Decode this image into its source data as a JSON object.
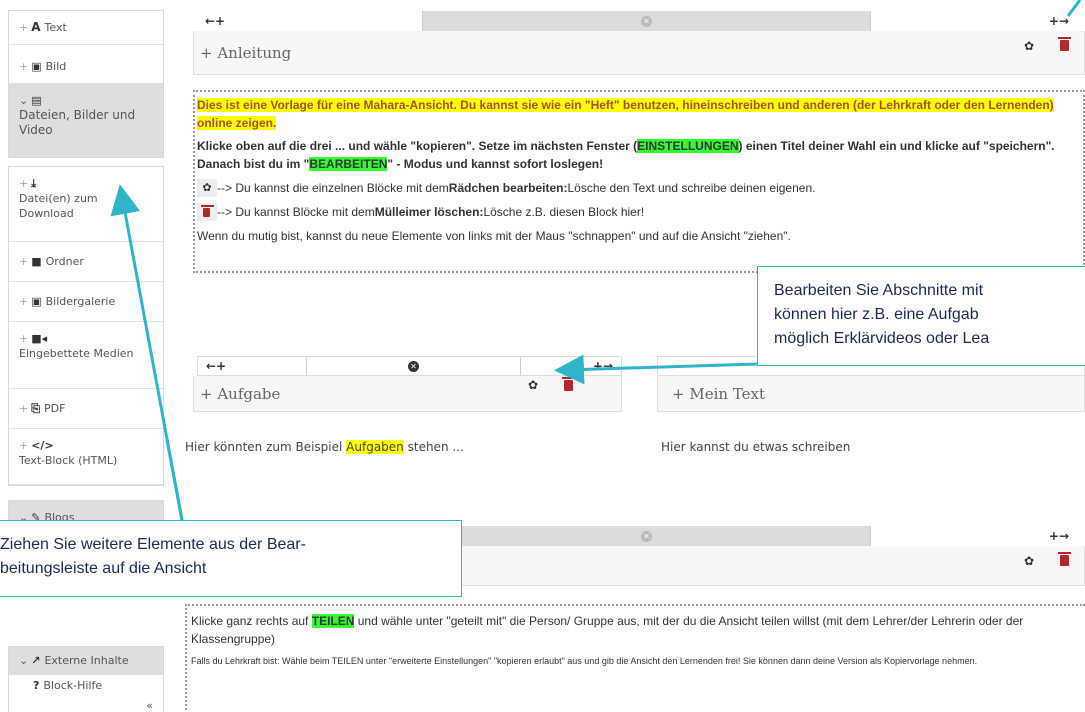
{
  "sidebar": {
    "items": [
      {
        "label": "Text",
        "icon": "text-A-icon"
      },
      {
        "label": "Bild",
        "icon": "image-icon"
      },
      {
        "label": "Dateien, Bilder und Video",
        "icon": "film-icon",
        "category": true
      },
      {
        "label": "Datei(en) zum Download",
        "icon": "download-icon"
      },
      {
        "label": "Ordner",
        "icon": "folder-icon"
      },
      {
        "label": "Bildergalerie",
        "icon": "gallery-icon"
      },
      {
        "label": "Eingebettete Medien",
        "icon": "video-camera-icon"
      },
      {
        "label": "PDF",
        "icon": "pdf-icon"
      },
      {
        "label": "Text-Block (HTML)",
        "icon": "code-icon"
      },
      {
        "label": "Blogs",
        "icon": "pencil-icon",
        "category": true
      },
      {
        "label": "Externe Inhalte",
        "icon": "external-link-icon",
        "category": true
      },
      {
        "label": "Block-Hilfe",
        "icon": "help-icon"
      }
    ],
    "collapse": "«"
  },
  "row_controls": {
    "left": "←+",
    "right": "+→"
  },
  "blocks": {
    "anleitung": {
      "title": "+ Anleitung"
    },
    "aufgabe": {
      "title": "+ Aufgabe",
      "body_pre": "Hier könnten zum Beispiel ",
      "body_hl": "Aufgaben",
      "body_post": " stehen ..."
    },
    "mein_text": {
      "title": "+ Mein Text",
      "body": "Hier kannst du etwas schreiben"
    }
  },
  "anleitung_content": {
    "p1": "Dies ist eine Vorlage für eine Mahara-Ansicht. Du kannst sie wie ein \"Heft\" benutzen, hineinschreiben und anderen (der Lehrkraft oder den Lernenden) online zeigen.",
    "p2_a": "Klicke oben auf die drei ... und wähle \"kopieren\". Setze im nächsten Fenster (",
    "p2_hl1": "EINSTELLUNGEN",
    "p2_b": ") einen Titel deiner Wahl ein und klicke auf \"speichern\". Danach bist du im \"",
    "p2_hl2": "BEARBEITEN",
    "p2_c": "\" - Modus und kannst sofort loslegen!",
    "p3_a": " --> Du kannst die einzelnen Blöcke mit dem ",
    "p3_b": "Rädchen bearbeiten:",
    "p3_c": " Lösche den Text und schreibe deinen eigenen.",
    "p4_a": " --> Du kannst Blöcke mit dem ",
    "p4_b": "Mülleimer löschen:",
    "p4_c": " Lösche z.B. diesen Block hier!",
    "p5": "Wenn du mutig bist, kannst du neue Elemente von links mit der Maus \"schnappen\" und auf die Ansicht \"ziehen\"."
  },
  "teilen_content": {
    "p1_a": "Klicke ganz rechts auf ",
    "p1_hl": "TEILEN",
    "p1_b": " und wähle unter \"geteilt mit\" die Person/ Gruppe aus, mit der du die Ansicht teilen willst (mit dem Lehrer/der Lehrerin oder der Klassengruppe)",
    "p2": "Falls du Lehrkraft bist: Wähle beim TEILEN unter \"erweiterte Einstellungen\" \"kopieren erlaubt\" aus und gib die Ansicht den Lernenden frei! Sie können dann deine Version als Kopiervorlage nehmen."
  },
  "callouts": {
    "right_l1": "Bearbeiten Sie Abschnitte mit",
    "right_l2": "können hier z.B. eine Aufgab",
    "right_l3": "möglich Erklärvideos oder Lea",
    "left_l1": "Ziehen Sie weitere Elemente aus der Bear-",
    "left_l2": "beitungsleiste auf die Ansicht"
  },
  "colors": {
    "highlight_yellow": "#ffff00",
    "highlight_green": "#33ff33",
    "callout_border": "#2fb5c9",
    "trash_red": "#b02a2a"
  }
}
